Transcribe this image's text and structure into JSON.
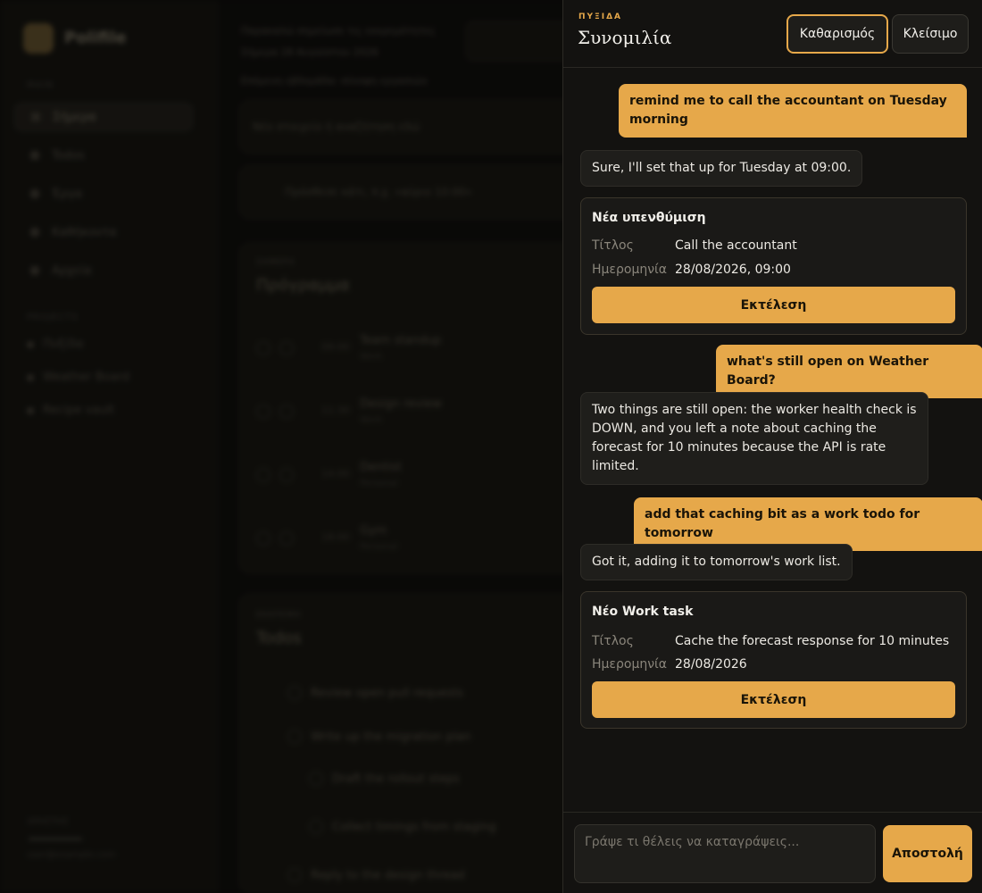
{
  "background": {
    "brand": "Polifile",
    "section_main": "MAIN",
    "nav": [
      "Σήμερα",
      "Todos",
      "Έργα",
      "Καθήκοντα",
      "Αρχεία"
    ],
    "section_projects": "PROJECTS",
    "projects": [
      "Πυξίδα",
      "Weather Board",
      "Recipe vault"
    ],
    "top_line_1": "Παρακαλώ σημείωσε τις εκκρεμότητες",
    "top_line_2": "Σήμερα 28 Αυγούστου 2026",
    "top_line_3": "Επόμενη εβδομάδα: σύνοψη εργασιών",
    "search_hint": "Νέο στοιχείο ή αναζήτηση εδώ",
    "quick_add": "Πρόσθεσε κάτι, π.χ. «αύριο 10:00»",
    "today_kicker": "ΣΗΜΕΡΑ",
    "today_title": "Πρόγραμμα",
    "rows": [
      {
        "time": "09:00",
        "name": "Team standup",
        "sub": "Work"
      },
      {
        "time": "11:30",
        "name": "Design review",
        "sub": "Work"
      },
      {
        "time": "14:00",
        "name": "Dentist",
        "sub": "Personal"
      },
      {
        "time": "18:00",
        "name": "Gym",
        "sub": "Personal"
      }
    ],
    "todos_kicker": "ΕΚΚΡΕΜΗ",
    "todos_title": "Todos",
    "todos": [
      "Review open pull requests",
      "Write up the migration plan",
      "Draft the rollout steps",
      "Collect timings from staging",
      "Reply to the design thread"
    ],
    "footer_label": "ΧΡΗΣΤΗΣ",
    "footer_email": "user@example.com"
  },
  "chat": {
    "kicker": "ΠΥΞΙΔΑ",
    "title": "Συνομιλία",
    "clear_label": "Καθαρισμός",
    "close_label": "Κλείσιμο",
    "messages": [
      {
        "role": "user",
        "text": "remind me to call the accountant on Tuesday morning"
      },
      {
        "role": "bot",
        "text": "Sure, I'll set that up for Tuesday at 09:00."
      },
      {
        "role": "user",
        "text": "what's still open on Weather Board?"
      },
      {
        "role": "bot",
        "text": "Two things are still open: the worker health check is DOWN, and you left a note about caching the forecast for 10 minutes because the API is rate limited."
      },
      {
        "role": "user",
        "text": "add that caching bit as a work todo for tomorrow"
      },
      {
        "role": "bot",
        "text": "Got it, adding it to tomorrow's work list."
      }
    ],
    "cards": [
      {
        "title": "Νέα υπενθύμιση",
        "title_label": "Τίτλος",
        "title_value": "Call the accountant",
        "date_label": "Ημερομηνία",
        "date_value": "28/08/2026, 09:00",
        "action": "Εκτέλεση"
      },
      {
        "title": "Νέο Work task",
        "title_label": "Τίτλος",
        "title_value": "Cache the forecast response for 10 minutes",
        "date_label": "Ημερομηνία",
        "date_value": "28/08/2026",
        "action": "Εκτέλεση"
      }
    ],
    "input_placeholder": "Γράψε τι θέλεις να καταγράψεις...",
    "send_label": "Αποστολή"
  },
  "colors": {
    "accent": "#e6a84a",
    "panel_bg": "#131210",
    "bubble_bot": "#1f1e1b"
  }
}
